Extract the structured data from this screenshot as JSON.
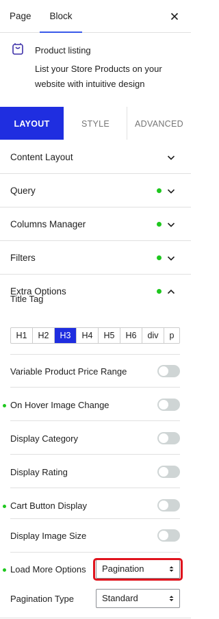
{
  "top_tabs": {
    "page": "Page",
    "block": "Block"
  },
  "block": {
    "icon": "store-bag-icon",
    "title": "Product listing",
    "description": "List your Store Products on your website with intuitive design"
  },
  "sub_tabs": {
    "layout": "LAYOUT",
    "style": "STYLE",
    "advanced": "ADVANCED"
  },
  "panels": [
    {
      "label": "Content Layout",
      "modified": false,
      "expanded": false
    },
    {
      "label": "Query",
      "modified": true,
      "expanded": false
    },
    {
      "label": "Columns Manager",
      "modified": true,
      "expanded": false
    },
    {
      "label": "Filters",
      "modified": true,
      "expanded": false
    },
    {
      "label": "Extra Options",
      "modified": true,
      "expanded": true
    }
  ],
  "extra_options": {
    "title_tag_label": "Title Tag",
    "title_tags": [
      "H1",
      "H2",
      "H3",
      "H4",
      "H5",
      "H6",
      "div",
      "p"
    ],
    "title_tag_selected": "H3",
    "toggles": [
      {
        "label": "Variable Product Price Range",
        "modified": false,
        "on": false
      },
      {
        "label": "On Hover Image Change",
        "modified": true,
        "on": false
      },
      {
        "label": "Display Category",
        "modified": false,
        "on": false
      },
      {
        "label": "Display Rating",
        "modified": false,
        "on": false
      },
      {
        "label": "Cart Button Display",
        "modified": true,
        "on": false
      },
      {
        "label": "Display Image Size",
        "modified": false,
        "on": false
      }
    ],
    "load_more": {
      "label": "Load More Options",
      "modified": true,
      "value": "Pagination"
    },
    "pagination_type": {
      "label": "Pagination Type",
      "value": "Standard"
    }
  },
  "colors": {
    "accent": "#1f2ee0",
    "tab_underline": "#3858e9",
    "modified_dot": "#1ec71e",
    "highlight": "#e0131d"
  }
}
